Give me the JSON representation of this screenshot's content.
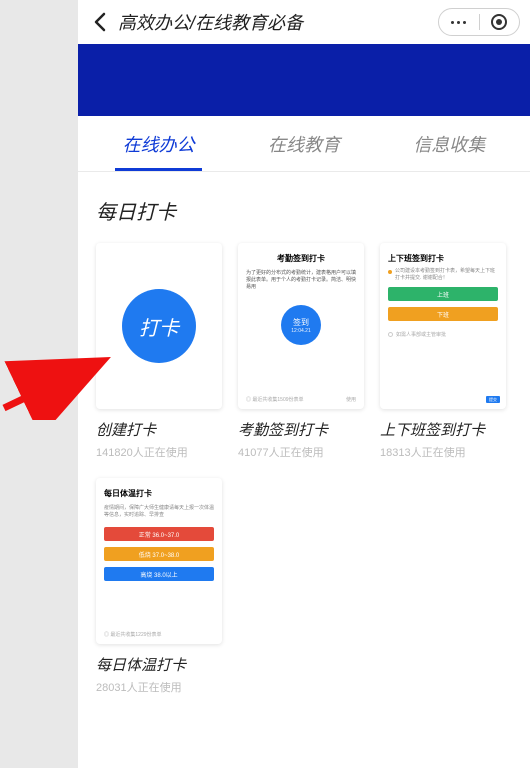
{
  "header": {
    "title": "高效办公/在线教育必备"
  },
  "tabs": [
    {
      "label": "在线办公",
      "active": true
    },
    {
      "label": "在线教育",
      "active": false
    },
    {
      "label": "信息收集",
      "active": false
    }
  ],
  "section": {
    "title": "每日打卡"
  },
  "cards": [
    {
      "title": "创建打卡",
      "sub": "141820人正在使用",
      "circle_label": "打卡"
    },
    {
      "title": "考勤签到打卡",
      "sub": "41077人正在使用",
      "mini_title": "考勤签到打卡",
      "mini_desc": "为了更好的分布式的考勤统计，建表格用户可以填报此表单。用于个人的考勤打卡记录。简洁、明快易用",
      "circle_t1": "签到",
      "circle_t2": "12:04.21",
      "foot_left": "◎ 最近共收集1509份表单",
      "foot_right": "使用"
    },
    {
      "title": "上下班签到打卡",
      "sub": "18313人正在使用",
      "mini_title": "上下班签到打卡",
      "note": "公司建设本考勤签到打卡表，希望每天上下班打卡并提交. 谢谢配合！",
      "btn_top": "上班",
      "btn_bot": "下班",
      "footer_left": "如需人事部或主管审批",
      "badge": "提交"
    },
    {
      "title": "每日体温打卡",
      "sub": "28031人正在使用",
      "mini_title": "每日体温打卡",
      "mini_desc": "疫情期间，保障广大师生健康请每天上报一次体温等信息，实时追踪、早排查",
      "btn1": "正常  36.0~37.0",
      "btn2": "低烧  37.0~38.0",
      "btn3": "高烧  38.0以上",
      "foot": "◎ 最近共收集1229份表单"
    }
  ]
}
